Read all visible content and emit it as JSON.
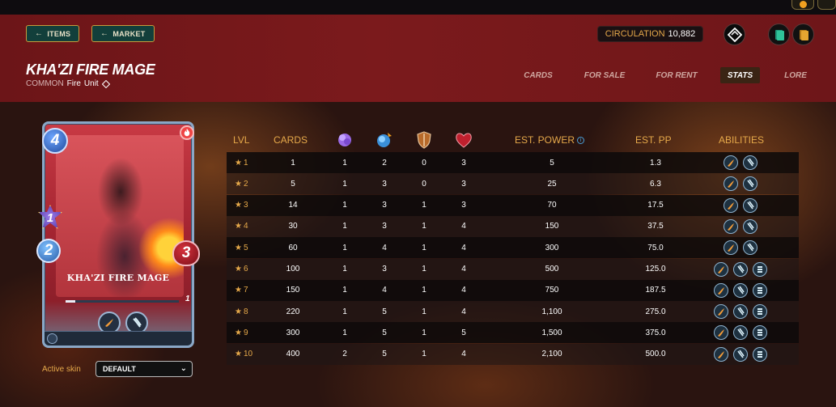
{
  "header": {
    "nav_buttons": [
      {
        "label": "ITEMS"
      },
      {
        "label": "MARKET"
      }
    ],
    "circulation_label": "CIRCULATION",
    "circulation_value": "10,882",
    "title": "KHA'ZI FIRE MAGE",
    "rarity": "COMMON",
    "element": "Fire",
    "type": "Unit",
    "tabs": [
      {
        "label": "CARDS",
        "active": false
      },
      {
        "label": "FOR SALE",
        "active": false
      },
      {
        "label": "FOR RENT",
        "active": false
      },
      {
        "label": "STATS",
        "active": true
      },
      {
        "label": "LORE",
        "active": false
      }
    ]
  },
  "card": {
    "name": "KHA'ZI FIRE MAGE",
    "mana": "4",
    "magic": "1",
    "speed": "2",
    "health": "3",
    "level": "1",
    "abilities": [
      "fire-fist-icon",
      "claw-icon"
    ]
  },
  "skin": {
    "label": "Active skin",
    "value": "DEFAULT"
  },
  "table": {
    "headers": {
      "lvl": "LVL",
      "cards": "CARDS",
      "magic_icon": "magic-icon",
      "speed_icon": "speed-icon",
      "armor_icon": "armor-icon",
      "health_icon": "health-icon",
      "est_power": "EST. POWER",
      "est_pp": "EST. PP",
      "abilities": "ABILITIES"
    },
    "rows": [
      {
        "lvl": "1",
        "cards": "1",
        "magic": "1",
        "speed": "2",
        "armor": "0",
        "health": "3",
        "power": "5",
        "pp": "1.3",
        "abilities": 2
      },
      {
        "lvl": "2",
        "cards": "5",
        "magic": "1",
        "speed": "3",
        "armor": "0",
        "health": "3",
        "power": "25",
        "pp": "6.3",
        "abilities": 2
      },
      {
        "lvl": "3",
        "cards": "14",
        "magic": "1",
        "speed": "3",
        "armor": "1",
        "health": "3",
        "power": "70",
        "pp": "17.5",
        "abilities": 2
      },
      {
        "lvl": "4",
        "cards": "30",
        "magic": "1",
        "speed": "3",
        "armor": "1",
        "health": "4",
        "power": "150",
        "pp": "37.5",
        "abilities": 2
      },
      {
        "lvl": "5",
        "cards": "60",
        "magic": "1",
        "speed": "4",
        "armor": "1",
        "health": "4",
        "power": "300",
        "pp": "75.0",
        "abilities": 2
      },
      {
        "lvl": "6",
        "cards": "100",
        "magic": "1",
        "speed": "3",
        "armor": "1",
        "health": "4",
        "power": "500",
        "pp": "125.0",
        "abilities": 3
      },
      {
        "lvl": "7",
        "cards": "150",
        "magic": "1",
        "speed": "4",
        "armor": "1",
        "health": "4",
        "power": "750",
        "pp": "187.5",
        "abilities": 3
      },
      {
        "lvl": "8",
        "cards": "220",
        "magic": "1",
        "speed": "5",
        "armor": "1",
        "health": "4",
        "power": "1,100",
        "pp": "275.0",
        "abilities": 3
      },
      {
        "lvl": "9",
        "cards": "300",
        "magic": "1",
        "speed": "5",
        "armor": "1",
        "health": "5",
        "power": "1,500",
        "pp": "375.0",
        "abilities": 3
      },
      {
        "lvl": "10",
        "cards": "400",
        "magic": "2",
        "speed": "5",
        "armor": "1",
        "health": "4",
        "power": "2,100",
        "pp": "500.0",
        "abilities": 3
      }
    ]
  },
  "colors": {
    "accent_gold": "#e6a94a",
    "header_red": "#7b1a1c",
    "button_teal": "#123f3b"
  }
}
